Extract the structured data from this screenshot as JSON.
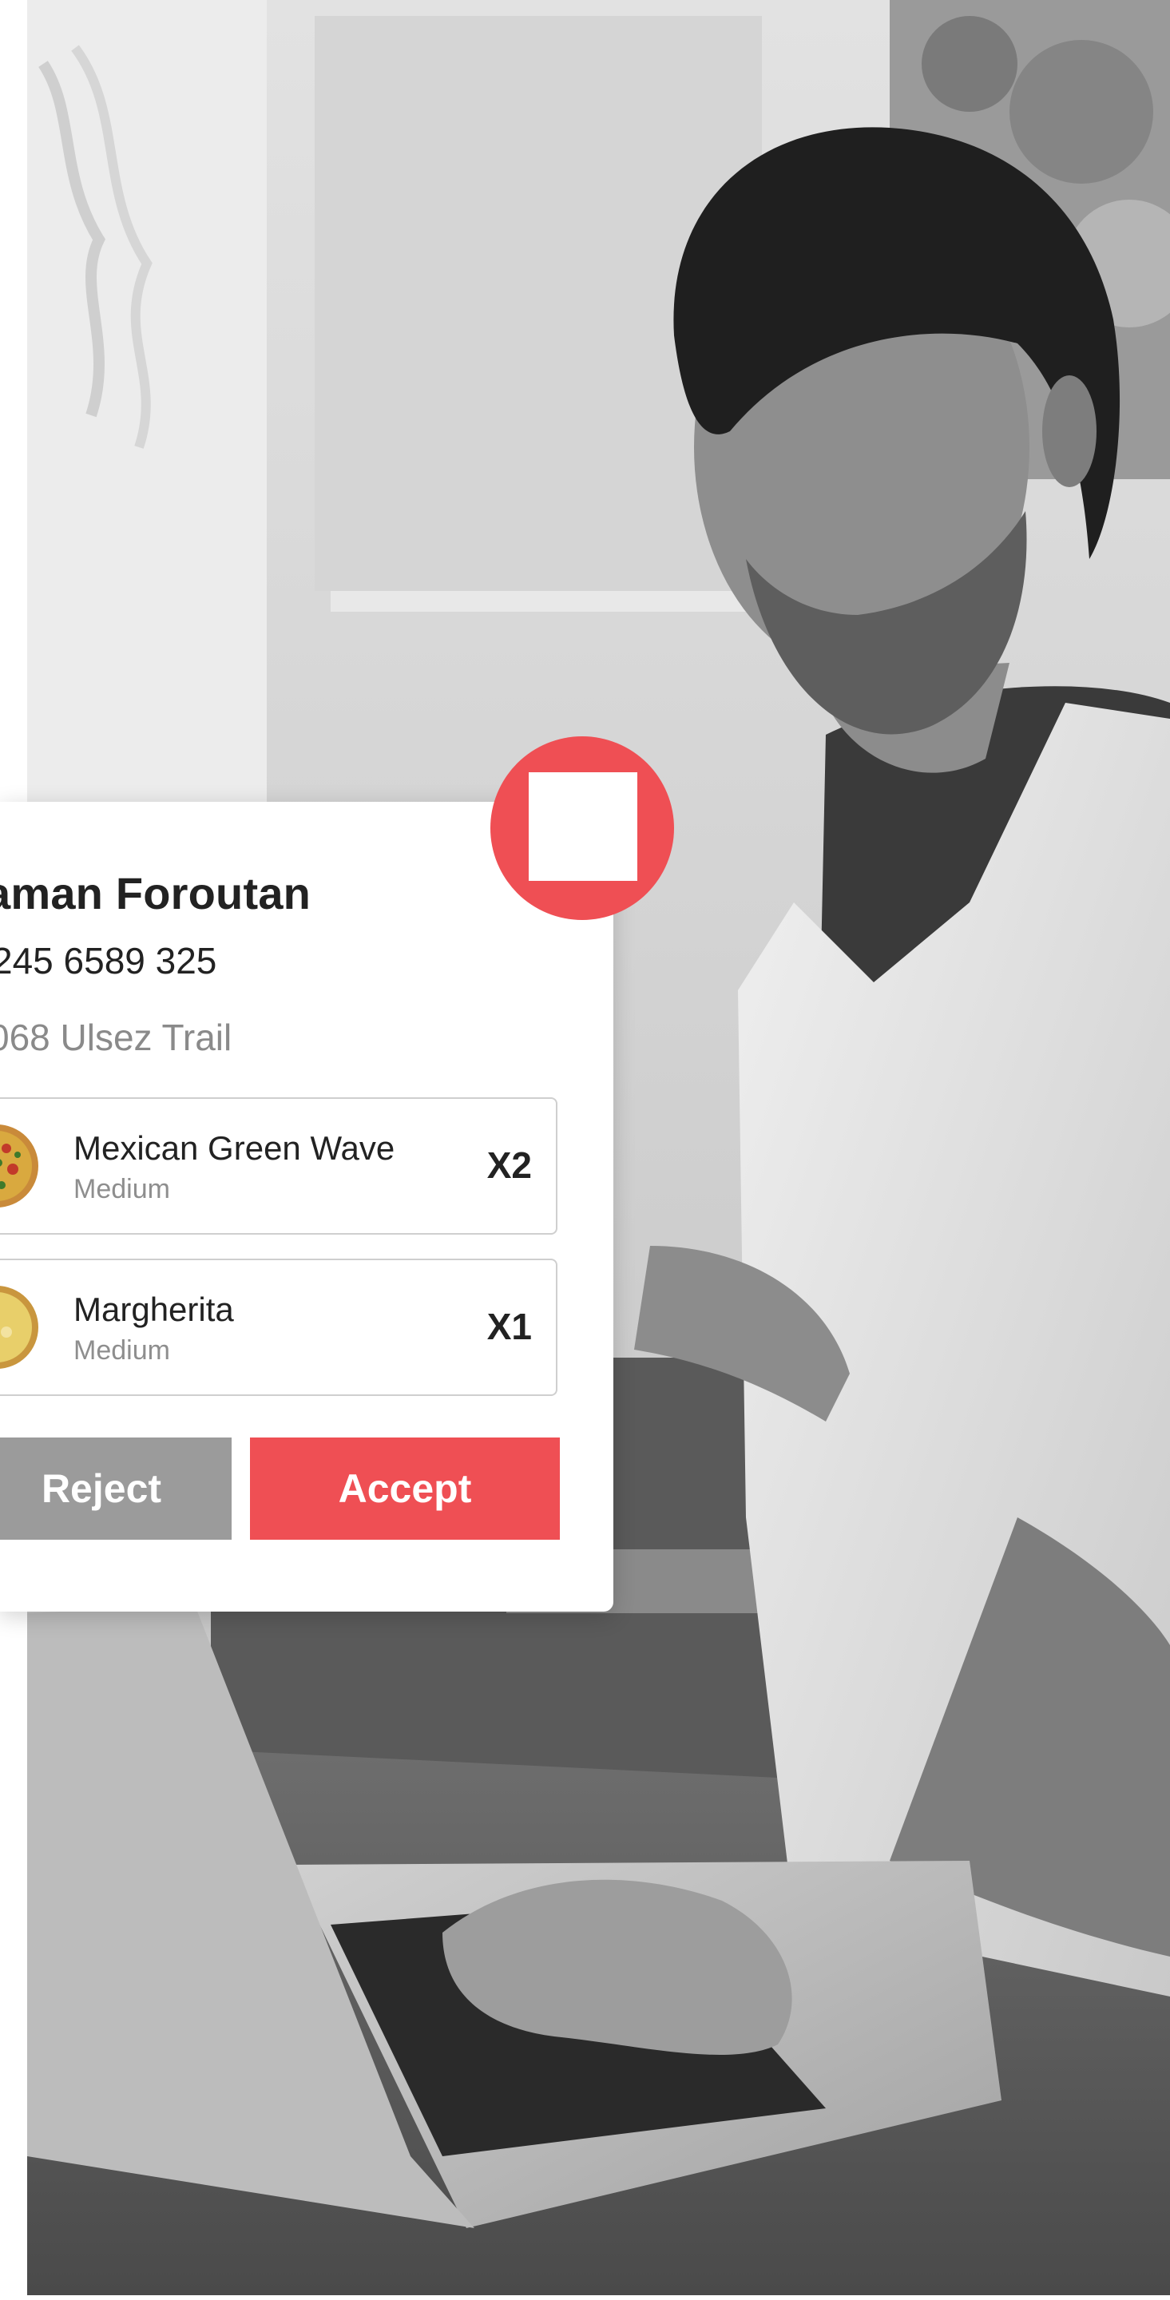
{
  "order": {
    "customer_name": "aman Foroutan",
    "phone": "245 6589 325",
    "address": "068 Ulsez Trail",
    "items": [
      {
        "name": "Mexican Green Wave",
        "size": "Medium",
        "quantity": "X2",
        "thumb_icon": "pizza-icon"
      },
      {
        "name": "Margherita",
        "size": "Medium",
        "quantity": "X1",
        "thumb_icon": "pizza-icon"
      }
    ],
    "reject_label": "Reject",
    "accept_label": "Accept"
  },
  "colors": {
    "accent": "#ef4f54",
    "reject": "#9b9b9b",
    "text_primary": "#222222",
    "text_secondary": "#8a8a8a"
  }
}
